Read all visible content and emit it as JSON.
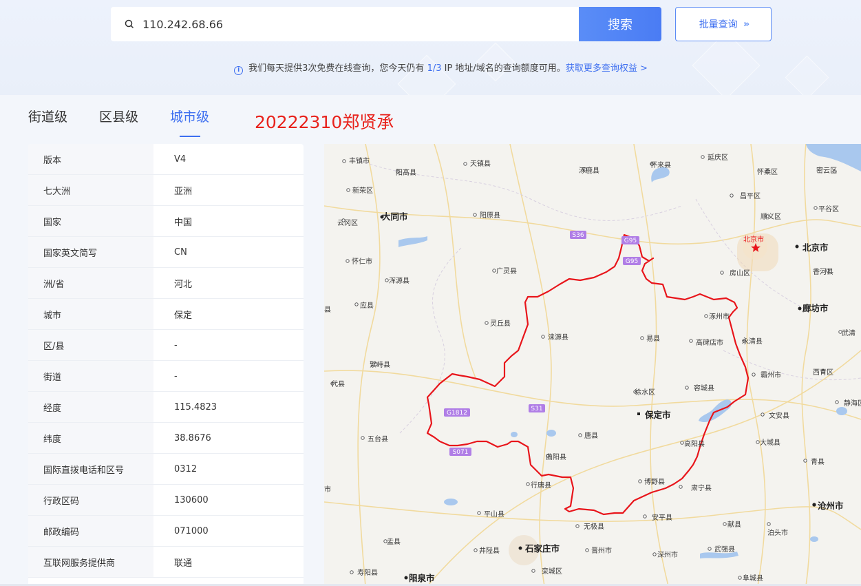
{
  "search": {
    "value": "110.242.68.66",
    "button": "搜索",
    "batch": "批量查询",
    "batch_arrows": "›››"
  },
  "notice": {
    "prefix": "我们每天提供3次免费在线查询，您今天仍有 ",
    "quota": "1/3",
    "suffix": " IP 地址/域名的查询额度可用。",
    "link": "获取更多查询权益 >"
  },
  "tabs": [
    {
      "label": "街道级",
      "active": false
    },
    {
      "label": "区县级",
      "active": false
    },
    {
      "label": "城市级",
      "active": true
    }
  ],
  "annotation": "20222310郑贤承",
  "info": [
    {
      "key": "版本",
      "value": "V4"
    },
    {
      "key": "七大洲",
      "value": "亚洲"
    },
    {
      "key": "国家",
      "value": "中国"
    },
    {
      "key": "国家英文简写",
      "value": "CN"
    },
    {
      "key": "洲/省",
      "value": "河北"
    },
    {
      "key": "城市",
      "value": "保定"
    },
    {
      "key": "区/县",
      "value": "-"
    },
    {
      "key": "街道",
      "value": "-"
    },
    {
      "key": "经度",
      "value": "115.4823"
    },
    {
      "key": "纬度",
      "value": "38.8676"
    },
    {
      "key": "国际直拨电话和区号",
      "value": "0312"
    },
    {
      "key": "行政区码",
      "value": "130600"
    },
    {
      "key": "邮政编码",
      "value": "071000"
    },
    {
      "key": "互联网服务提供商",
      "value": "联通"
    }
  ],
  "map": {
    "colors": {
      "boundary": "#e8151b",
      "water": "#a9c8ee",
      "shield": "#b07ee6",
      "road": "#f1d58a"
    },
    "labels": {
      "fengzhen": "丰镇市",
      "yanggao": "阳高县",
      "tianzhen": "天镇县",
      "zhuolu": "涿鹿县",
      "huailai": "怀来县",
      "yanqing": "延庆区",
      "huairou": "怀柔区",
      "miyun": "密云区",
      "xinrong": "新荣区",
      "changping": "昌平区",
      "datong": "大同市",
      "yangyuan": "阳原县",
      "pinggu": "平谷区",
      "yungang": "云冈区",
      "shunyi": "顺义区",
      "beijing_star": "北京市",
      "beijing": "北京市",
      "huairen": "怀仁市",
      "fangshan": "房山区",
      "xianghe": "香河县",
      "hunyuan": "浑源县",
      "guangling": "广灵县",
      "ying": "应县",
      "ji": "县",
      "langfang": "廊坊市",
      "zhuozhou": "涿州市",
      "lingqiu": "灵丘县",
      "laiyuan": "涞源县",
      "yixian": "易县",
      "gaobeidian": "高碑店市",
      "yongqing": "永清县",
      "wuqing": "武清",
      "fanshi": "繁峙县",
      "bazhou": "霸州市",
      "xiqing": "西青区",
      "daixian": "代县",
      "xushui": "徐水区",
      "rongcheng": "容城县",
      "jinghai": "静海区",
      "baoding": "保定市",
      "wenan": "文安县",
      "wutai": "五台县",
      "tangxian": "唐县",
      "gaoyang": "高阳县",
      "dacheng": "大城县",
      "quyang": "曲阳县",
      "qingxian": "青县",
      "shi": "市",
      "xingtang": "行唐县",
      "boye": "博野县",
      "suning": "肃宁县",
      "pingshan": "平山县",
      "anping": "安平县",
      "cangzhou": "沧州市",
      "wuji": "无极县",
      "xianxian": "献县",
      "botou": "泊头市",
      "yu": "盂县",
      "jingxing": "井陉县",
      "shijiazhuang": "石家庄市",
      "jinzhou": "晋州市",
      "shenzhou": "深州市",
      "wuqiang": "武强县",
      "shouyang": "寿阳县",
      "yangquan": "阳泉市",
      "luancheng": "栾城区",
      "fucheng": "阜城县"
    },
    "shields": {
      "s36": "S36",
      "g95a": "G95",
      "g95b": "G95",
      "g1812": "G1812",
      "s31": "S31",
      "s071": "S071"
    }
  }
}
